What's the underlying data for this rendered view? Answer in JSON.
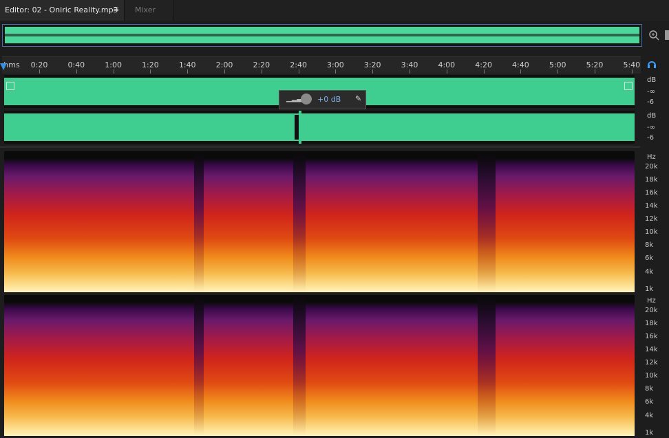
{
  "tabs": {
    "editor": "Editor: 02 - Oniric Reality.mp3",
    "editor_menu": "≡",
    "mixer": "Mixer"
  },
  "ruler": {
    "unit": "hms",
    "ticks": [
      "0:20",
      "0:40",
      "1:00",
      "1:20",
      "1:40",
      "2:00",
      "2:20",
      "2:40",
      "3:00",
      "3:20",
      "3:40",
      "4:00",
      "4:20",
      "4:40",
      "5:00",
      "5:20",
      "5:40"
    ]
  },
  "hud": {
    "value": "+0 dB"
  },
  "waveform_scale": {
    "channels": [
      {
        "unit": "dB",
        "labels": [
          "-∞",
          "-6"
        ]
      },
      {
        "unit": "dB",
        "labels": [
          "-∞",
          "-6"
        ]
      }
    ]
  },
  "spectral_scale": {
    "unit": "Hz",
    "labels": [
      "20k",
      "18k",
      "16k",
      "14k",
      "12k",
      "10k",
      "8k",
      "6k",
      "4k",
      "1k"
    ]
  },
  "colors": {
    "waveform": "#3fce90",
    "accent": "#3b8fe0"
  }
}
